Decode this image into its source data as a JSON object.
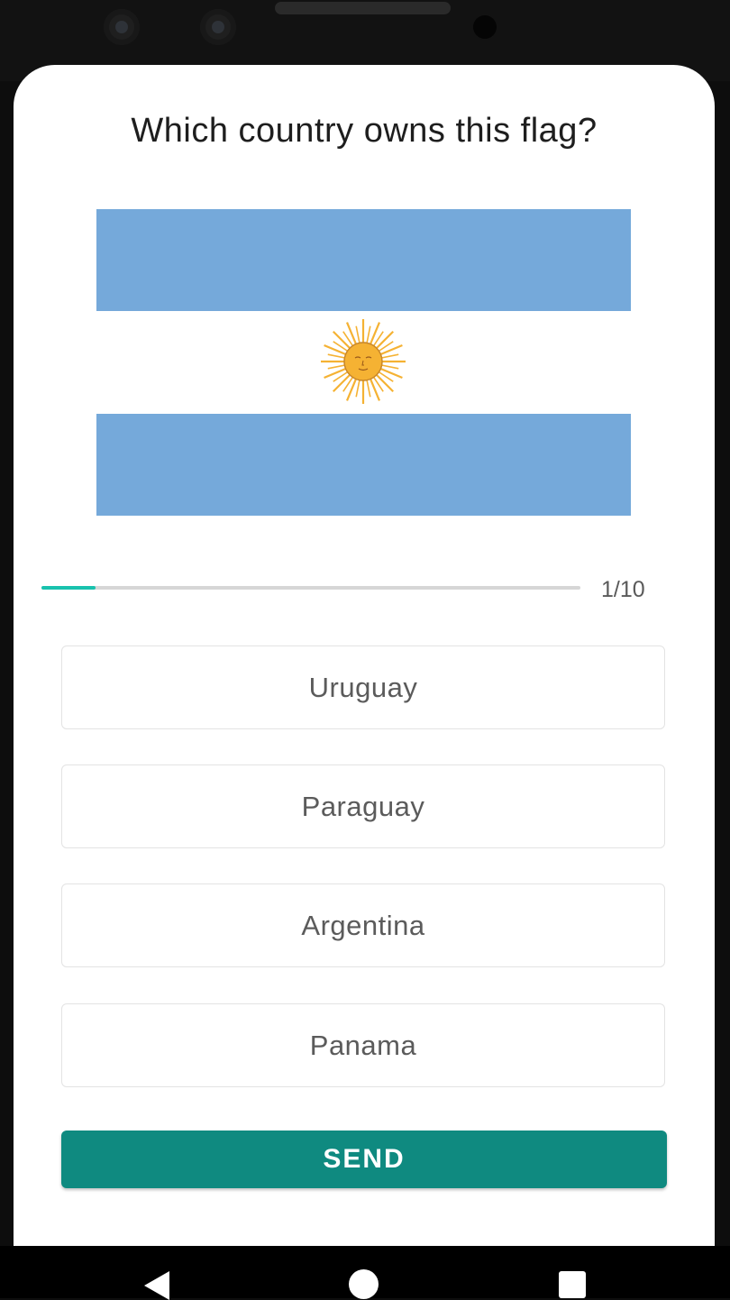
{
  "quiz": {
    "question": "Which country owns this flag?",
    "flag": {
      "country_depicted": "argentina",
      "stripe_color": "#75a9da",
      "sun_color": "#f5b233"
    },
    "progress": {
      "label": "1/10",
      "fraction": 0.1
    },
    "options": [
      {
        "label": "Uruguay"
      },
      {
        "label": "Paraguay"
      },
      {
        "label": "Argentina"
      },
      {
        "label": "Panama"
      }
    ],
    "send_label": "SEND"
  },
  "colors": {
    "accent": "#0f8a80",
    "progress": "#19c2ae"
  },
  "navbar": {
    "icons": [
      "back-icon",
      "home-icon",
      "recents-icon"
    ]
  }
}
